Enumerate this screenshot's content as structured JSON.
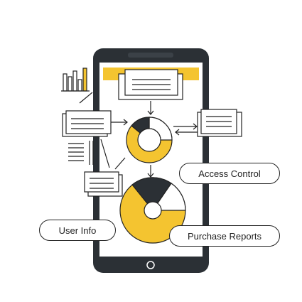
{
  "colors": {
    "ink": "#222222",
    "phone_body": "#2b3035",
    "screen": "#ffffff",
    "accent_yellow": "#f4c430",
    "card_fill": "#ffffff"
  },
  "icons": {
    "phone": "smartphone-icon",
    "bar_chart": "bar-chart-icon",
    "donut": "donut-chart-icon",
    "pie": "pie-chart-icon",
    "document": "document-icon",
    "arrow": "arrow-icon"
  },
  "labels": {
    "access_control": "Access Control",
    "user_info": "User Info",
    "purchase_reports": "Purchase Reports"
  }
}
